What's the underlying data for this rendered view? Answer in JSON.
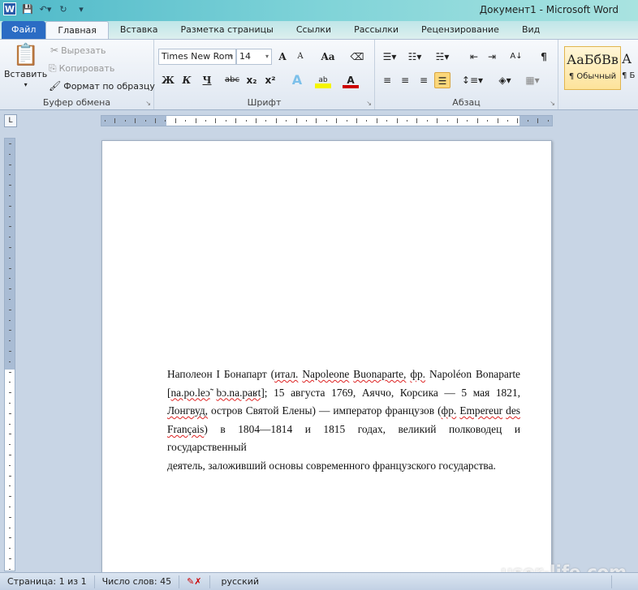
{
  "window": {
    "title": "Документ1  -  Microsoft Word",
    "app_icon": "W"
  },
  "qat": {
    "save_icon": "save-icon",
    "undo_icon": "undo-icon",
    "redo_icon": "redo-icon",
    "customize_icon": "customize-icon"
  },
  "tabs": [
    {
      "label": "Файл"
    },
    {
      "label": "Главная"
    },
    {
      "label": "Вставка"
    },
    {
      "label": "Разметка страницы"
    },
    {
      "label": "Ссылки"
    },
    {
      "label": "Рассылки"
    },
    {
      "label": "Рецензирование"
    },
    {
      "label": "Вид"
    }
  ],
  "ribbon": {
    "clipboard": {
      "label": "Буфер обмена",
      "paste": "Вставить",
      "cut": "Вырезать",
      "copy": "Копировать",
      "format_painter": "Формат по образцу"
    },
    "font": {
      "label": "Шрифт",
      "font_name": "Times New Rom",
      "font_size": "14",
      "bold": "Ж",
      "italic": "К",
      "underline": "Ч",
      "strike": "abc",
      "sub": "x₂",
      "sup": "x²",
      "grow": "A",
      "shrink": "A",
      "case": "Aa",
      "clear": "A",
      "effects": "A",
      "highlight": "ab",
      "color": "A"
    },
    "paragraph": {
      "label": "Абзац",
      "show_marks": "¶",
      "sort": "A↓"
    },
    "styles": {
      "items": [
        {
          "preview": "АаБбВв",
          "name": "¶ Обычный"
        },
        {
          "preview": "А",
          "name": "¶ Б"
        }
      ]
    }
  },
  "document": {
    "lines": [
      [
        {
          "t": "Наполеон I Бонапарт ("
        },
        {
          "t": "итал.",
          "s": 1
        },
        {
          "t": " "
        },
        {
          "t": "Napoleone",
          "s": 1
        },
        {
          "t": " "
        },
        {
          "t": "Buonaparte,",
          "s": 1
        },
        {
          "t": " "
        },
        {
          "t": "фр.",
          "s": 1
        },
        {
          "t": " Napoléon Bonaparte"
        }
      ],
      [
        {
          "t": "["
        },
        {
          "t": "na.po.leɔ̃",
          "s": 1
        },
        {
          "t": " "
        },
        {
          "t": "bɔ.na.paʁt",
          "s": 1
        },
        {
          "t": "]; 15 августа 1769, Аяччо, Корсика — 5 мая 1821,"
        }
      ],
      [
        {
          "t": "Лонгвуд,",
          "s": 1
        },
        {
          "t": " остров Святой Елены) — император французов ("
        },
        {
          "t": "фр.",
          "s": 1
        },
        {
          "t": " "
        },
        {
          "t": "Empereur",
          "s": 1
        },
        {
          "t": " "
        },
        {
          "t": "des",
          "s": 1
        }
      ],
      [
        {
          "t": "Français",
          "s": 1
        },
        {
          "t": ") в 1804—1814 и 1815 годах, великий полководец и государственный"
        }
      ],
      [
        {
          "t": "деятель, заложивший основы современного французского государства."
        }
      ]
    ]
  },
  "status": {
    "page": "Страница: 1 из 1",
    "words": "Число слов: 45",
    "proofing_icon": "proofing-error-icon",
    "language": "русский"
  },
  "watermark": "user-life.com",
  "colors": {
    "file_tab": "#2b6cc4",
    "titlebar": "#4fb9c9",
    "active_style": "#fbd77a"
  }
}
